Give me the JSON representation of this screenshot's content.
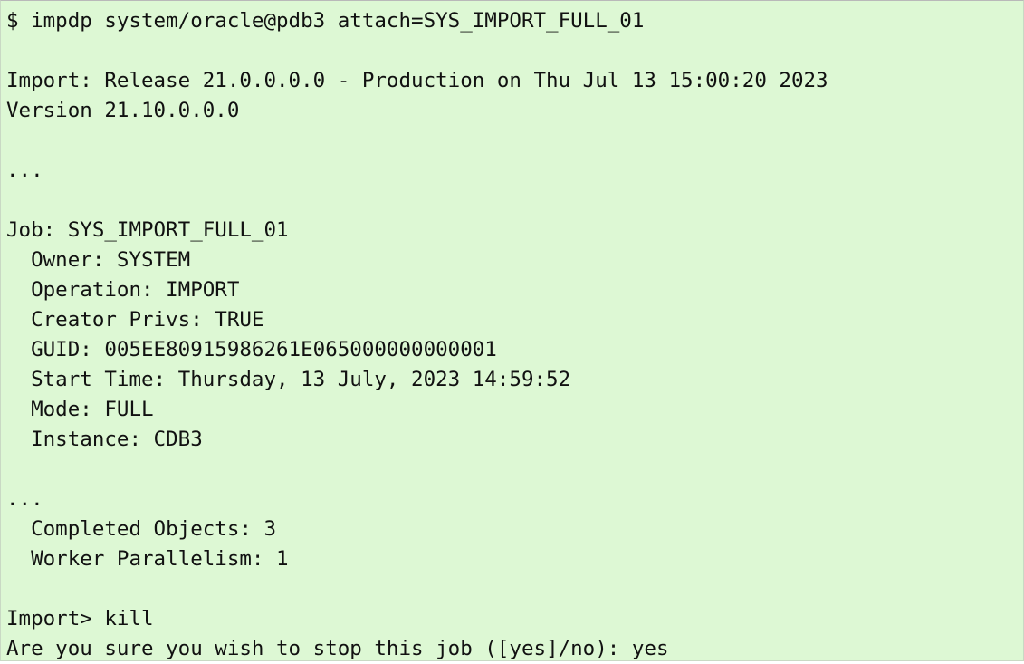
{
  "terminal": {
    "lines": [
      "$ impdp system/oracle@pdb3 attach=SYS_IMPORT_FULL_01",
      "",
      "Import: Release 21.0.0.0.0 - Production on Thu Jul 13 15:00:20 2023",
      "Version 21.10.0.0.0",
      "",
      "...",
      "",
      "Job: SYS_IMPORT_FULL_01",
      "  Owner: SYSTEM",
      "  Operation: IMPORT",
      "  Creator Privs: TRUE",
      "  GUID: 005EE80915986261E065000000000001",
      "  Start Time: Thursday, 13 July, 2023 14:59:52",
      "  Mode: FULL",
      "  Instance: CDB3",
      "",
      "...",
      "  Completed Objects: 3",
      "  Worker Parallelism: 1",
      "",
      "Import> kill",
      "Are you sure you wish to stop this job ([yes]/no): yes"
    ]
  }
}
